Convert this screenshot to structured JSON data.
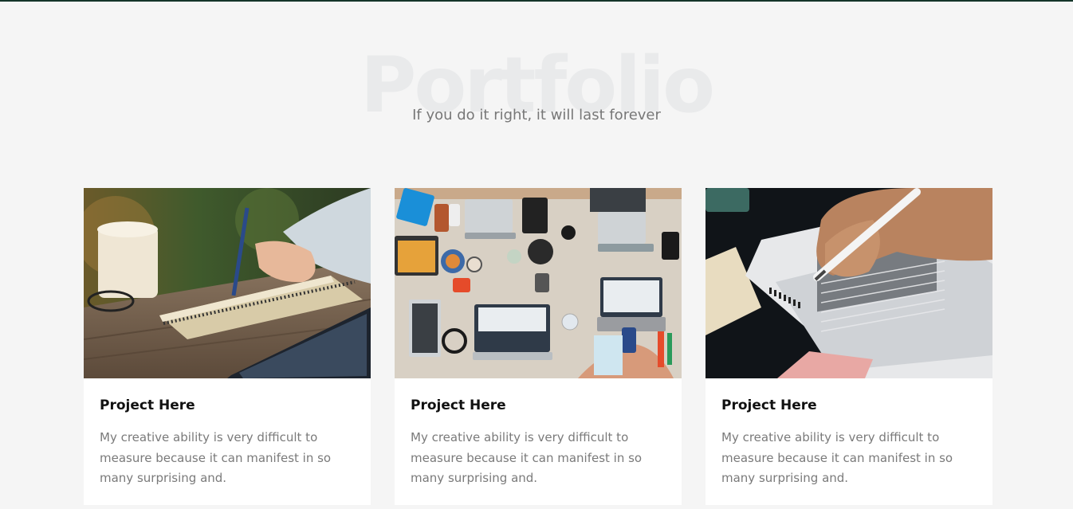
{
  "header": {
    "background_title": "Portfolio",
    "subtitle": "If you do it right, it will last forever"
  },
  "colors": {
    "accent_line": "#15352a",
    "page_bg": "#f5f5f5",
    "card_bg": "#ffffff"
  },
  "projects": [
    {
      "title": "Project Here",
      "description": "My creative ability is very difficult to measure because it can manifest in so many surprising and.",
      "image": "person writing in notebook with coffee cup and tablet"
    },
    {
      "title": "Project Here",
      "description": "My creative ability is very difficult to measure because it can manifest in so many surprising and.",
      "image": "team desk with laptops and phones from above"
    },
    {
      "title": "Project Here",
      "description": "My creative ability is very difficult to measure because it can manifest in so many surprising and.",
      "image": "hand filling answer sheet with pencil"
    }
  ]
}
